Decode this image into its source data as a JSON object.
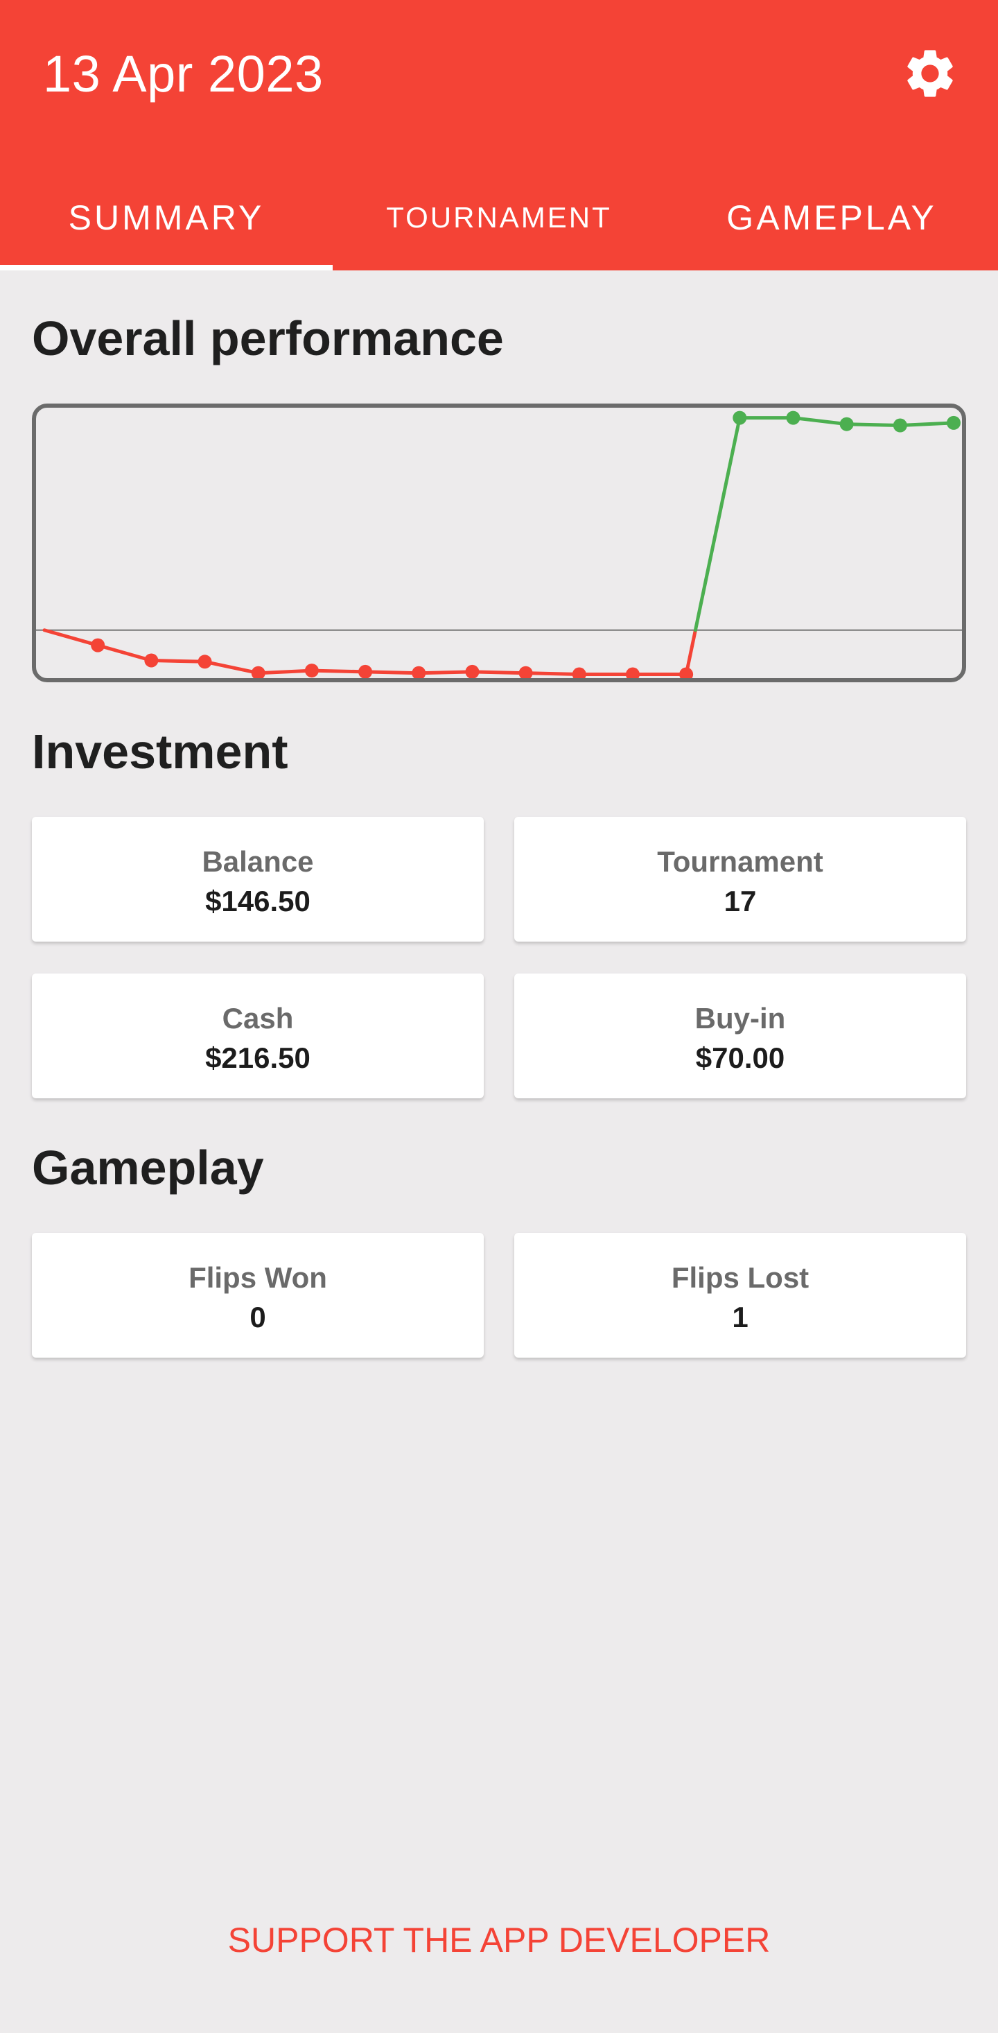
{
  "header": {
    "title": "13 Apr 2023",
    "settings_icon": "gear-icon",
    "background": "#f44336"
  },
  "tabs": [
    {
      "label": "SUMMARY",
      "selected": true
    },
    {
      "label": "TOURNAMENT",
      "selected": false
    },
    {
      "label": "GAMEPLAY",
      "selected": false
    }
  ],
  "sections": {
    "performance_title": "Overall performance",
    "investment_title": "Investment",
    "gameplay_title": "Gameplay"
  },
  "investment": {
    "balance": {
      "label": "Balance",
      "value": "$146.50"
    },
    "tournament": {
      "label": "Tournament",
      "value": "17"
    },
    "cash": {
      "label": "Cash",
      "value": "$216.50"
    },
    "buyin": {
      "label": "Buy-in",
      "value": "$70.00"
    }
  },
  "gameplay": {
    "flips_won": {
      "label": "Flips Won",
      "value": "0"
    },
    "flips_lost": {
      "label": "Flips Lost",
      "value": "1"
    }
  },
  "footer": {
    "support_label": "SUPPORT THE APP DEVELOPER"
  },
  "colors": {
    "negative": "#f44336",
    "positive": "#4caf50",
    "baseline": "#777777"
  },
  "chart_data": {
    "type": "line",
    "baseline": 0,
    "ylim": [
      -19,
      88
    ],
    "grid": false,
    "legend": "none",
    "x": [
      0,
      1,
      2,
      3,
      4,
      5,
      6,
      7,
      8,
      9,
      10,
      11,
      12,
      13,
      14,
      15,
      16,
      17
    ],
    "values": [
      0,
      -6,
      -12,
      -12.5,
      -17,
      -16,
      -16.5,
      -17,
      -16.5,
      -17,
      -17.5,
      -17.5,
      -17.5,
      84,
      84,
      81.5,
      81,
      82
    ]
  }
}
